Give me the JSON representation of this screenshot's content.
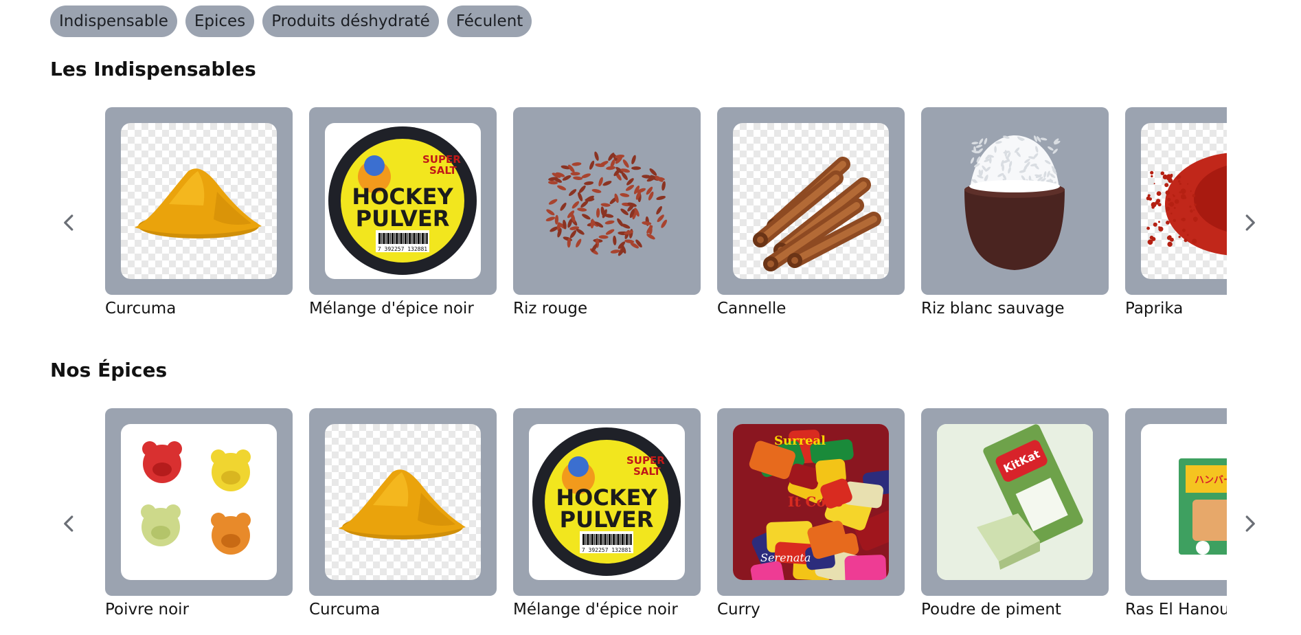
{
  "tabs": [
    "Indispensable",
    "Epices",
    "Produits déshydraté",
    "Féculent"
  ],
  "sections": [
    {
      "title": "Les Indispensables",
      "products": [
        {
          "name": "Curcuma",
          "image": "turmeric-powder"
        },
        {
          "name": "Mélange d'épice noir",
          "image": "hockey-pulver-tin"
        },
        {
          "name": "Riz rouge",
          "image": "red-rice"
        },
        {
          "name": "Cannelle",
          "image": "cinnamon-sticks"
        },
        {
          "name": "Riz blanc sauvage",
          "image": "rice-bowl"
        },
        {
          "name": "Paprika",
          "image": "paprika-powder"
        }
      ]
    },
    {
      "title": "Nos Épices",
      "products": [
        {
          "name": "Poivre noir",
          "image": "gummy-bears"
        },
        {
          "name": "Curcuma",
          "image": "turmeric-powder"
        },
        {
          "name": "Mélange d'épice noir",
          "image": "hockey-pulver-tin"
        },
        {
          "name": "Curry",
          "image": "wrapped-candies"
        },
        {
          "name": "Poudre de piment",
          "image": "matcha-kitkat"
        },
        {
          "name": "Ras El Hanout",
          "image": "snack-box"
        }
      ]
    }
  ],
  "tin_label": {
    "line1": "HOCKEY",
    "line2": "PULVER",
    "badge_line1": "SUPER",
    "badge_line2": "SALT",
    "barcode": "7 392257 132881"
  },
  "candy_label": {
    "brand1": "Surreal",
    "brand2": "It Coco",
    "brand3": "Serenata"
  },
  "kitkat_label": {
    "brand": "KitKat"
  },
  "snack_label": {
    "brand": "ハンバーガー"
  },
  "colors": {
    "tab_bg": "#9ba3b0",
    "card_bg": "#9ba3b0",
    "text": "#111111"
  }
}
